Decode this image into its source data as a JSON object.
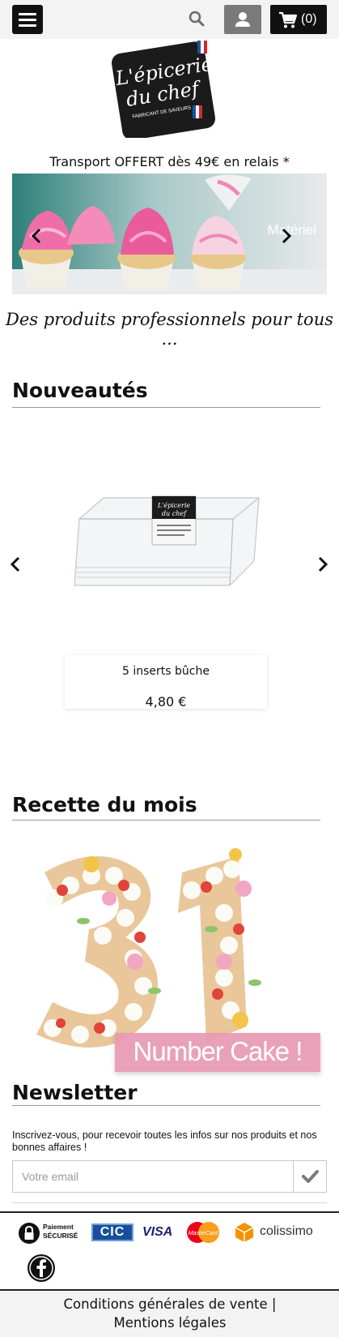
{
  "header": {
    "menu_icon": "hamburger-icon",
    "search_icon": "search-icon",
    "account_icon": "user-icon",
    "cart_icon": "cart-icon",
    "cart_count": "(0)"
  },
  "logo": {
    "line1": "L'épicerie",
    "line2": "du chef",
    "subtitle": "FABRICANT DE SAVEURS"
  },
  "shipping_banner": "Transport OFFERT dès 49€ en relais *",
  "slider": {
    "label": "Matériel",
    "prev_icon": "chevron-left-icon",
    "next_icon": "chevron-right-icon"
  },
  "tagline": "Des produits professionnels pour tous ...",
  "new_products": {
    "title": "Nouveautés",
    "product_name": "5 inserts bûche",
    "product_price": "4,80 €",
    "prev_icon": "chevron-left-icon",
    "next_icon": "chevron-right-icon"
  },
  "recipe": {
    "title": "Recette du mois",
    "banner": "Number Cake !"
  },
  "newsletter": {
    "title": "Newsletter",
    "text": "Inscrivez-vous, pour recevoir toutes les infos sur nos produits et nos bonnes affaires !",
    "placeholder": "Votre email",
    "submit_icon": "check-icon"
  },
  "footer": {
    "secure_line1": "Paiement",
    "secure_line2": "SÉCURISÉ",
    "cic": "CIC",
    "visa": "VISA",
    "mastercard": "MasterCard",
    "colissimo": "colissimo",
    "facebook_icon": "facebook-icon",
    "legal": "Conditions générales de vente | Mentions légales"
  },
  "colors": {
    "header_bg": "#f3f3f3",
    "dark": "#111111",
    "grey_button": "#7a7a7a",
    "pink_banner": "#e89ab5",
    "cic_blue": "#1a4e9a",
    "visa_blue": "#1a1f71",
    "colissimo_orange": "#f39200"
  }
}
